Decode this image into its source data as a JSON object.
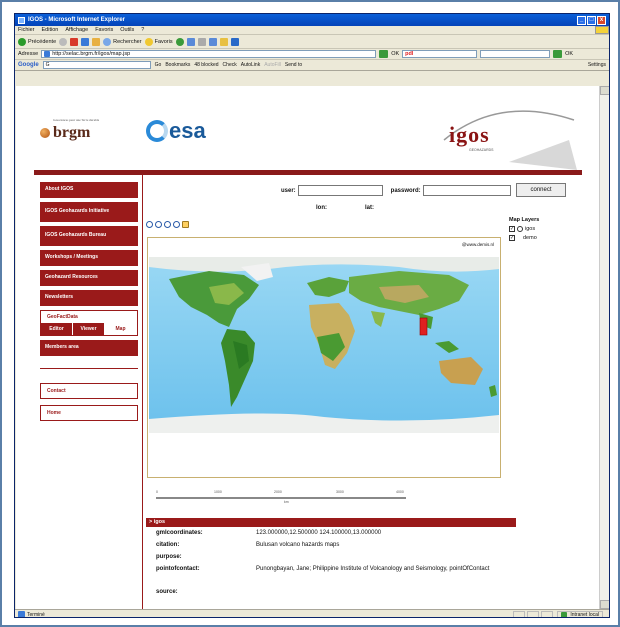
{
  "window": {
    "title": "IGOS - Microsoft Internet Explorer",
    "buttons": [
      "_",
      "□",
      "x"
    ]
  },
  "menubar": {
    "items": [
      "Fichier",
      "Edition",
      "Affichage",
      "Favoris",
      "Outils",
      "?"
    ]
  },
  "toolbar": {
    "back": "Précédente",
    "search": "Rechercher",
    "favorites": "Favoris"
  },
  "address": {
    "label": "Adresse",
    "url": "http://selac.brgm.fr/igos/map.jsp",
    "ok": "OK",
    "pdl": "pdl"
  },
  "googlebar": {
    "logo": "Google",
    "search_value": "G",
    "go": "Go",
    "bookmarks": "Bookmarks",
    "blocked": "48 blocked",
    "check": "Check",
    "autolink": "AutoLink",
    "autofill": "AutoFill",
    "sendto": "Send to",
    "settings": "Settings"
  },
  "page": {
    "brgm": "brgm",
    "brgm_tagline": "Géosciences pour une Terre durable",
    "esa": "esa",
    "igos": "igos",
    "igos_sub": "GEOHAZARDS",
    "nav": [
      "About IGOS",
      "IGOS Geohazards Initiative",
      "IGOS Geohazards Bureau",
      "Workshops / Meetings",
      "Geohazard Resources",
      "Newsletters"
    ],
    "geofactdata": {
      "title": "GeoFactData",
      "tabs": [
        "Editor",
        "Viewer",
        "Map"
      ]
    },
    "members": "Members area",
    "contact": "Contact",
    "home": "Home",
    "login": {
      "user_label": "user:",
      "password_label": "password:",
      "connect": "connect"
    },
    "coords": {
      "lon": "lon:",
      "lat": "lat:"
    },
    "map_layers": {
      "title": "Map Layers",
      "layers": [
        "igos",
        "demo"
      ]
    },
    "map_copyright": "@www.demis.nl",
    "scale_labels": [
      "0",
      "1000",
      "2000",
      "3000",
      "4000"
    ],
    "scale_unit": "km",
    "info": {
      "header": "> igos",
      "rows": [
        {
          "key": "gmlcoordinates:",
          "value": "123.000000,12.500000 124.100000,13.000000"
        },
        {
          "key": "citation:",
          "value": "Bulusan volcano hazards maps"
        },
        {
          "key": "purpose:",
          "value": ""
        },
        {
          "key": "pointofcontact:",
          "value": "Punongbayan, Jane; Philippine Institute of Volcanology and Seismology, pointOfContact"
        },
        {
          "key": "source:",
          "value": ""
        }
      ]
    }
  },
  "status": {
    "text": "Terminé",
    "zone": "Intranet local"
  }
}
